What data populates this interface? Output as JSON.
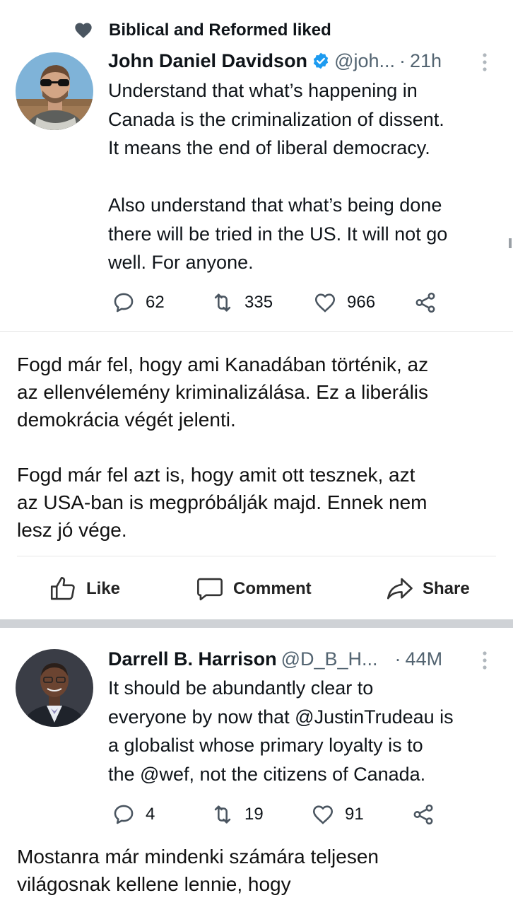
{
  "tweet1": {
    "social_context": "Biblical and Reformed liked",
    "author_name": "John Daniel Davidson",
    "handle": "@joh...",
    "separator": "·",
    "time": "21h",
    "text": "Understand that what’s happening in\nCanada is the criminalization of dissent.\nIt means the end of liberal democracy.\n\nAlso understand that what’s being done\nthere will be tried in the US. It will not go\nwell. For anyone.",
    "replies": "62",
    "retweets": "335",
    "likes": "966"
  },
  "translation1": {
    "text": "Fogd már fel, hogy ami Kanadában történik, az\naz ellenvélemény kriminalizálása. Ez a liberális\ndemokrácia végét jelenti.\n\nFogd már fel azt is, hogy amit ott tesznek, azt\naz USA-ban is megpróbálják majd. Ennek nem\nlesz jó vége."
  },
  "post_actions": {
    "like_label": "Like",
    "comment_label": "Comment",
    "share_label": "Share"
  },
  "tweet2": {
    "author_name": "Darrell B. Harrison",
    "handle": "@D_B_H...",
    "separator": "·",
    "time": "44M",
    "text": "It should be abundantly clear to\neveryone by now that @JustinTrudeau is\na globalist whose primary loyalty is to\nthe @wef, not the citizens of Canada.",
    "replies": "4",
    "retweets": "19",
    "likes": "91"
  },
  "translation2": {
    "text": "Mostanra már mindenki számára teljesen\nvilágosnak kellene lennie, hogy"
  },
  "colors": {
    "text_primary": "#0f1419",
    "text_secondary": "#536471",
    "verified_blue": "#1d9bf0",
    "separator_band": "#cfd2d6"
  },
  "icons": {
    "liked": "heart-filled-icon",
    "verified": "verified-badge-icon",
    "more": "more-vertical-icon",
    "reply": "reply-icon",
    "retweet": "retweet-icon",
    "like": "heart-outline-icon",
    "share": "share-icon",
    "fb_like": "thumbs-up-icon",
    "fb_comment": "comment-bubble-icon",
    "fb_share": "share-arrow-icon"
  }
}
